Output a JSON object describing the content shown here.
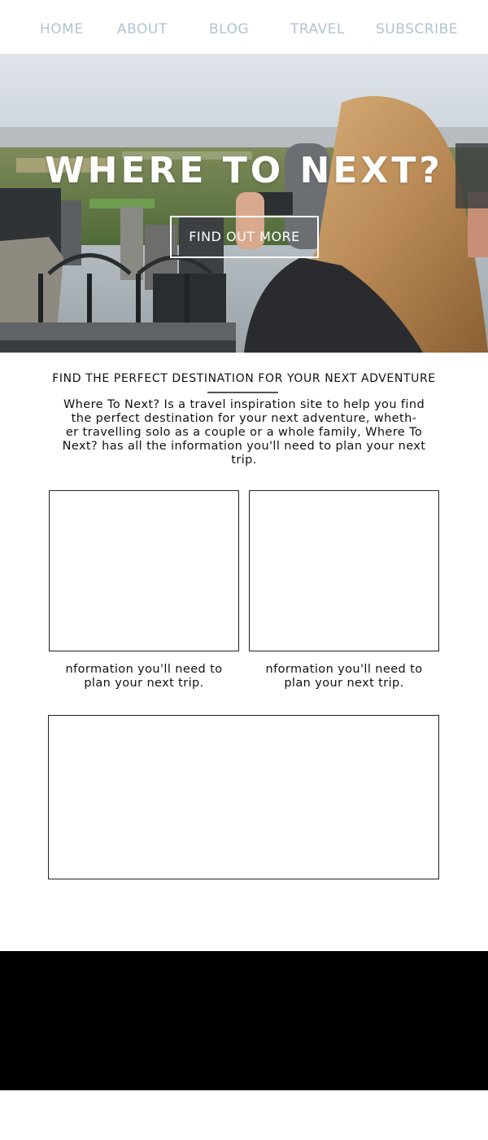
{
  "nav": {
    "items": [
      "HOME",
      "ABOUT",
      "BLOG",
      "TRAVEL",
      "SUBSCRIBE"
    ],
    "color": "#b1c3d3"
  },
  "hero": {
    "title": "WHERE TO NEXT?",
    "button_label": "FIND OUT MORE"
  },
  "intro": {
    "heading": "FIND THE PERFECT DESTINATION FOR YOUR NEXT ADVENTURE",
    "text_lines": [
      "Where To Next? Is a travel inspiration site to help you find",
      "the perfect destination for your next adventure, wheth-",
      "er travelling solo as a couple or a whole family, Where To",
      "Next? has all the information you'll need to plan your next",
      "trip."
    ]
  },
  "cards": [
    {
      "caption_lines": [
        "nformation you'll need to",
        "plan your next trip."
      ]
    },
    {
      "caption_lines": [
        "nformation you'll need to",
        "plan your next trip."
      ]
    }
  ],
  "colors": {
    "footer": "#000000",
    "box_border": "#222222"
  }
}
